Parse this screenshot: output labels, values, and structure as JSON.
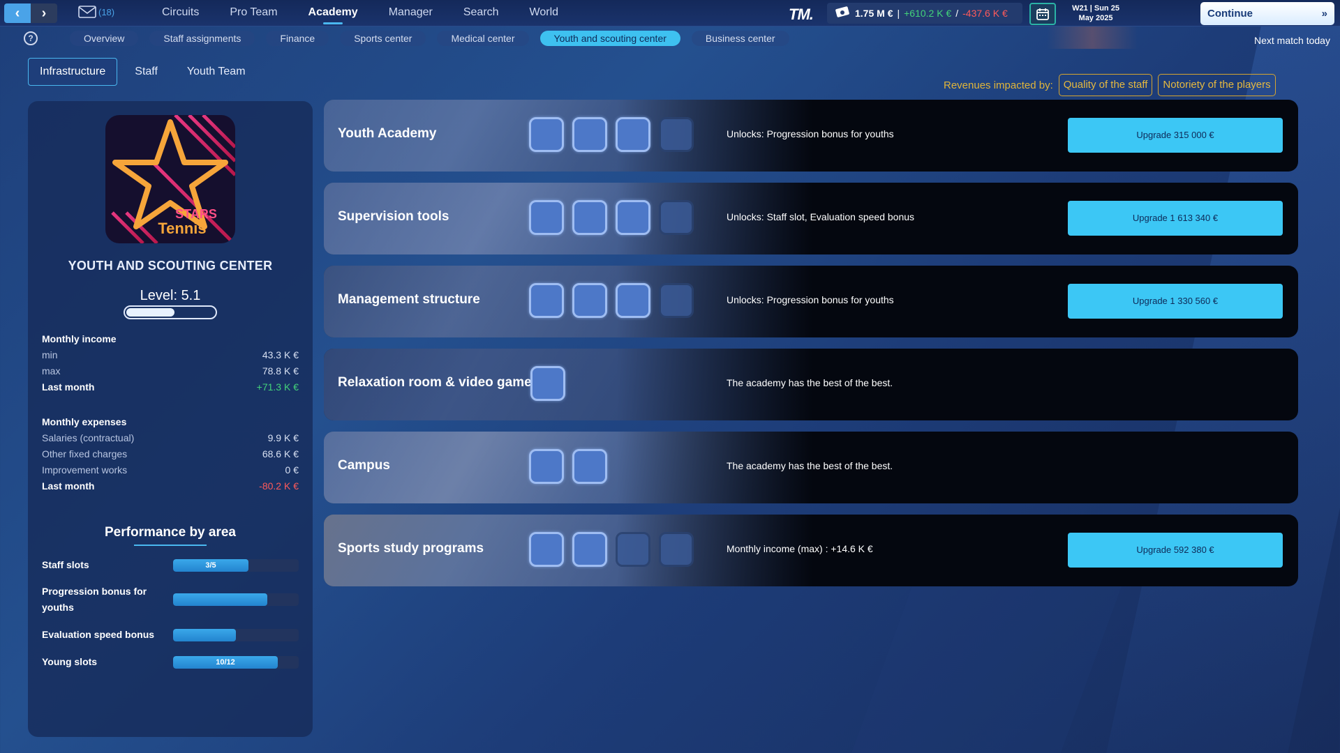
{
  "nav": {
    "mail_count": "(18)",
    "items": [
      "Circuits",
      "Pro Team",
      "Academy",
      "Manager",
      "Search",
      "World"
    ],
    "active": "Academy"
  },
  "brand": "TM.",
  "finance": {
    "balance": "1.75 M €",
    "sep1": "|",
    "income": "+610.2 K €",
    "sep2": "/",
    "expenses": "-437.6 K €"
  },
  "date": {
    "week_day": "W21 | Sun 25",
    "month_year": "May 2025"
  },
  "continue_label": "Continue",
  "next_match": "Next match today",
  "subtabs": [
    "Overview",
    "Staff assignments",
    "Finance",
    "Sports center",
    "Medical center",
    "Youth and scouting center",
    "Business center"
  ],
  "subtab_active_index": 5,
  "innertabs": [
    "Infrastructure",
    "Staff",
    "Youth Team"
  ],
  "innertab_active_index": 0,
  "revenues": {
    "label": "Revenues impacted by:",
    "tags": [
      "Quality of the staff",
      "Notoriety of the players"
    ]
  },
  "left": {
    "logo_text_1": "STARS",
    "logo_text_2": "Tennis",
    "title": "YOUTH AND SCOUTING CENTER",
    "level_label": "Level:",
    "level_value": "5.1",
    "level_progress": 0.55,
    "monthly_income": {
      "label": "Monthly income",
      "rows": [
        {
          "label": "min",
          "value": "43.3 K €"
        },
        {
          "label": "max",
          "value": "78.8 K €"
        }
      ],
      "last_label": "Last month",
      "last_value": "+71.3 K €"
    },
    "monthly_expenses": {
      "label": "Monthly expenses",
      "rows": [
        {
          "label": "Salaries (contractual)",
          "value": "9.9 K €"
        },
        {
          "label": "Other fixed charges",
          "value": "68.6 K €"
        },
        {
          "label": "Improvement works",
          "value": "0 €"
        }
      ],
      "last_label": "Last month",
      "last_value": "-80.2 K €"
    },
    "performance_title": "Performance by area",
    "performance": [
      {
        "label": "Staff slots",
        "text": "3/5",
        "fraction": 0.6
      },
      {
        "label": "Progression bonus for youths",
        "text": "",
        "fraction": 0.75
      },
      {
        "label": "Evaluation speed bonus",
        "text": "",
        "fraction": 0.5
      },
      {
        "label": "Young slots",
        "text": "10/12",
        "fraction": 0.833
      }
    ]
  },
  "infrastructure": [
    {
      "name": "Youth Academy",
      "level": 3,
      "max": 4,
      "desc": "Unlocks: Progression bonus for youths",
      "button": "Upgrade 315 000 €"
    },
    {
      "name": "Supervision tools",
      "level": 3,
      "max": 4,
      "desc": "Unlocks: Staff slot, Evaluation speed bonus",
      "button": "Upgrade 1 613 340 €"
    },
    {
      "name": "Management structure",
      "level": 3,
      "max": 4,
      "desc": "Unlocks: Progression bonus for youths",
      "button": "Upgrade 1 330 560 €"
    },
    {
      "name": "Relaxation room & video games",
      "level": 1,
      "max": 1,
      "desc": "The academy has the best of the best.",
      "button": ""
    },
    {
      "name": "Campus",
      "level": 2,
      "max": 2,
      "desc": "The academy has the best of the best.",
      "button": ""
    },
    {
      "name": "Sports study programs",
      "level": 2,
      "max": 4,
      "desc": "Monthly income (max) : +14.6 K €",
      "button": "Upgrade 592 380 €"
    }
  ],
  "colors": {
    "accent": "#3ec1f0",
    "positive": "#43d37a",
    "negative": "#ff5a5a",
    "gold": "#e0b53a"
  }
}
